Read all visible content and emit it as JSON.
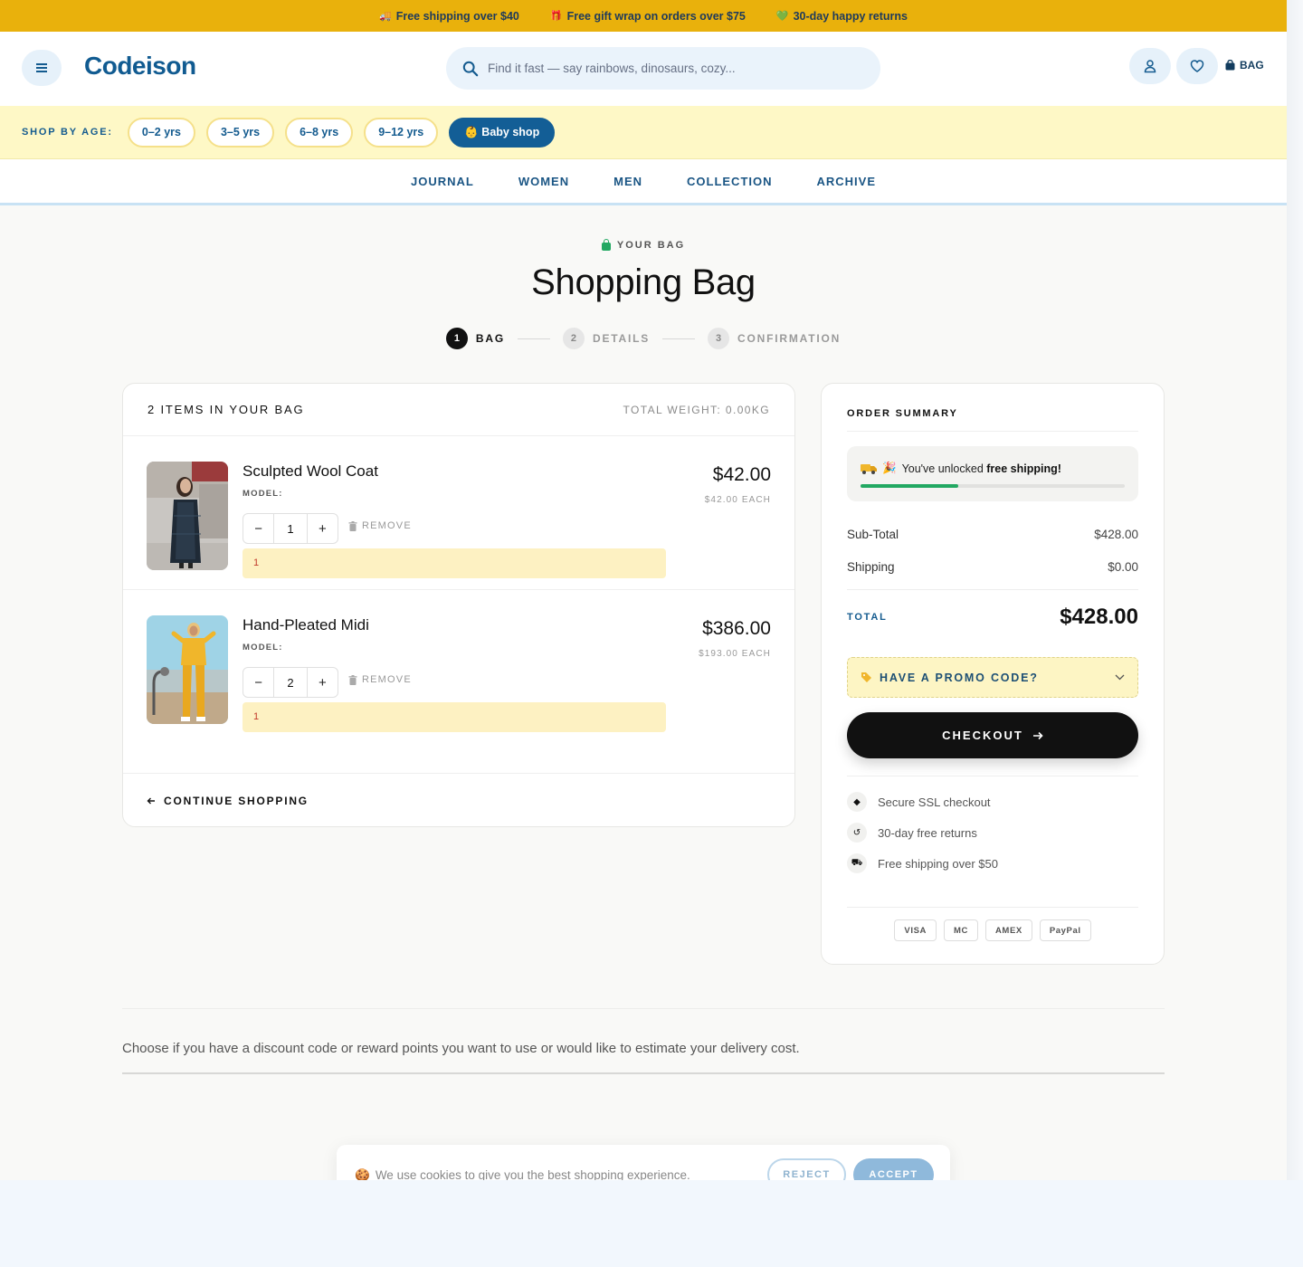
{
  "announcement": [
    {
      "icon": "truck-icon",
      "glyph": "🚚",
      "text": "Free shipping over $40"
    },
    {
      "icon": "gift-icon",
      "glyph": "🎁",
      "text": "Free gift wrap on orders over $75"
    },
    {
      "icon": "heart-icon",
      "glyph": "💚",
      "text": "30-day happy returns"
    }
  ],
  "header": {
    "logo": "Codeison",
    "search_placeholder": "Find it fast — say rainbows, dinosaurs, cozy...",
    "bag_label": "BAG"
  },
  "age_bar": {
    "label": "SHOP BY AGE:",
    "pills": [
      "0–2 yrs",
      "3–5 yrs",
      "6–8 yrs",
      "9–12 yrs"
    ],
    "active_pill": "👶 Baby shop"
  },
  "nav": [
    "JOURNAL",
    "WOMEN",
    "MEN",
    "COLLECTION",
    "ARCHIVE"
  ],
  "page": {
    "eyebrow": "YOUR BAG",
    "title": "Shopping Bag",
    "steps": [
      {
        "num": "1",
        "label": "BAG"
      },
      {
        "num": "2",
        "label": "DETAILS"
      },
      {
        "num": "3",
        "label": "CONFIRMATION"
      }
    ]
  },
  "cart": {
    "count_label": "2 ITEMS IN YOUR BAG",
    "weight_label": "TOTAL WEIGHT: 0.00KG",
    "items": [
      {
        "name": "Sculpted Wool Coat",
        "model": "MODEL:",
        "qty": "1",
        "remove": "REMOVE",
        "note": "1",
        "price": "$42.00",
        "each": "$42.00 EACH"
      },
      {
        "name": "Hand-Pleated Midi",
        "model": "MODEL:",
        "qty": "2",
        "remove": "REMOVE",
        "note": "1",
        "price": "$386.00",
        "each": "$193.00 EACH"
      }
    ],
    "continue": "CONTINUE SHOPPING"
  },
  "summary": {
    "title": "ORDER SUMMARY",
    "ship_prefix": "You've unlocked ",
    "ship_bold": "free shipping!",
    "ship_progress": 0.37,
    "subtotal_label": "Sub-Total",
    "subtotal": "$428.00",
    "shipping_label": "Shipping",
    "shipping": "$0.00",
    "total_label": "TOTAL",
    "total": "$428.00",
    "promo": "HAVE A PROMO CODE?",
    "checkout": "CHECKOUT",
    "trust": [
      "Secure SSL checkout",
      "30-day free returns",
      "Free shipping over $50"
    ],
    "payments": [
      "VISA",
      "MC",
      "AMEX",
      "PayPal"
    ]
  },
  "info_text": "Choose if you have a discount code or reward points you want to use or would like to estimate your delivery cost.",
  "cookie": {
    "text": "We use cookies to give you the best shopping experience.",
    "reject": "REJECT",
    "accept": "ACCEPT"
  },
  "colors": {
    "brand": "#115b91",
    "announce_bg": "#e9b10c",
    "age_bg": "#fef8c6",
    "success": "#22a862"
  }
}
